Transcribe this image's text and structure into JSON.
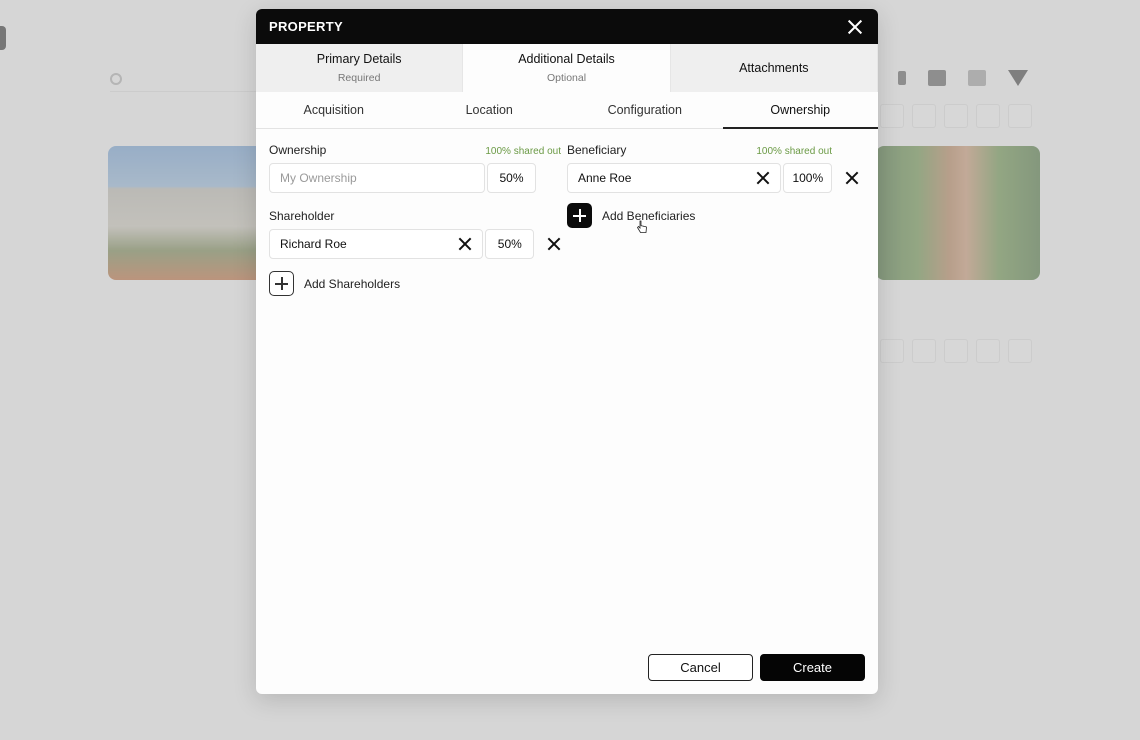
{
  "modal": {
    "title": "PROPERTY",
    "steps": [
      {
        "label": "Primary Details",
        "sub": "Required"
      },
      {
        "label": "Additional Details",
        "sub": "Optional"
      },
      {
        "label": "Attachments",
        "sub": ""
      }
    ],
    "subtabs": [
      "Acquisition",
      "Location",
      "Configuration",
      "Ownership"
    ],
    "ownership": {
      "label": "Ownership",
      "shared": "100% shared out",
      "placeholder": "My Ownership",
      "percent": "50%"
    },
    "shareholder": {
      "label": "Shareholder",
      "name": "Richard Roe",
      "percent": "50%",
      "add_label": "Add Shareholders"
    },
    "beneficiary": {
      "label": "Beneficiary",
      "shared": "100% shared out",
      "name": "Anne Roe",
      "percent": "100%",
      "add_label": "Add Beneficiaries"
    },
    "footer": {
      "cancel": "Cancel",
      "create": "Create"
    }
  }
}
